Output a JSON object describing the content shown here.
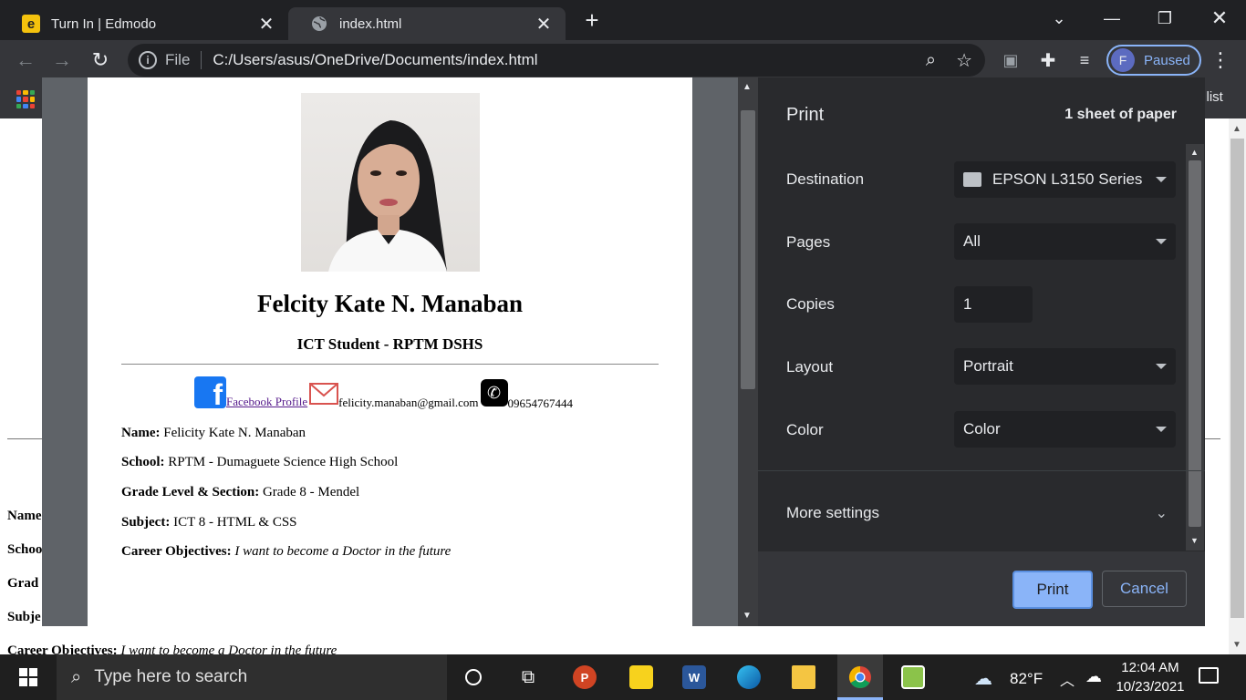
{
  "browser": {
    "tabs": [
      {
        "title": "Turn In | Edmodo",
        "icon": "edmodo-icon"
      },
      {
        "title": "index.html",
        "icon": "globe-icon"
      }
    ],
    "url_scheme": "File",
    "url": "C:/Users/asus/OneDrive/Documents/index.html",
    "profile_initial": "F",
    "profile_status": "Paused",
    "reading_list_partial": "g list"
  },
  "underlying_page": {
    "labels": [
      "Name",
      "Schoo",
      "Grad",
      "Subje"
    ],
    "career_label": "Career Objectives:",
    "career_text": "I want to become a Doctor in the future"
  },
  "print_dialog": {
    "title": "Print",
    "sheet_count": "1 sheet of paper",
    "destination_label": "Destination",
    "destination_value": "EPSON L3150 Series",
    "pages_label": "Pages",
    "pages_value": "All",
    "copies_label": "Copies",
    "copies_value": "1",
    "layout_label": "Layout",
    "layout_value": "Portrait",
    "color_label": "Color",
    "color_value": "Color",
    "more_settings": "More settings",
    "print_button": "Print",
    "cancel_button": "Cancel"
  },
  "preview": {
    "name": "Felcity Kate N. Manaban",
    "role": "ICT Student - RPTM DSHS",
    "facebook_link": "Facebook Profile",
    "email": "felicity.manaban@gmail.com",
    "phone": "09654767444",
    "rows": [
      {
        "label": "Name:",
        "value": "Felicity Kate N. Manaban",
        "italic": false
      },
      {
        "label": "School:",
        "value": "RPTM - Dumaguete Science High School",
        "italic": false
      },
      {
        "label": "Grade Level & Section:",
        "value": "Grade 8 - Mendel",
        "italic": false
      },
      {
        "label": "Subject:",
        "value": "ICT 8 - HTML & CSS",
        "italic": false
      },
      {
        "label": "Career Objectives:",
        "value": "I want to become a Doctor in the future",
        "italic": true
      }
    ]
  },
  "taskbar": {
    "search_placeholder": "Type here to search",
    "temperature": "82°F",
    "time": "12:04 AM",
    "date": "10/23/2021"
  },
  "colors": {
    "accent": "#8ab4f8",
    "panel": "#292a2d",
    "chrome_dark": "#202124"
  }
}
